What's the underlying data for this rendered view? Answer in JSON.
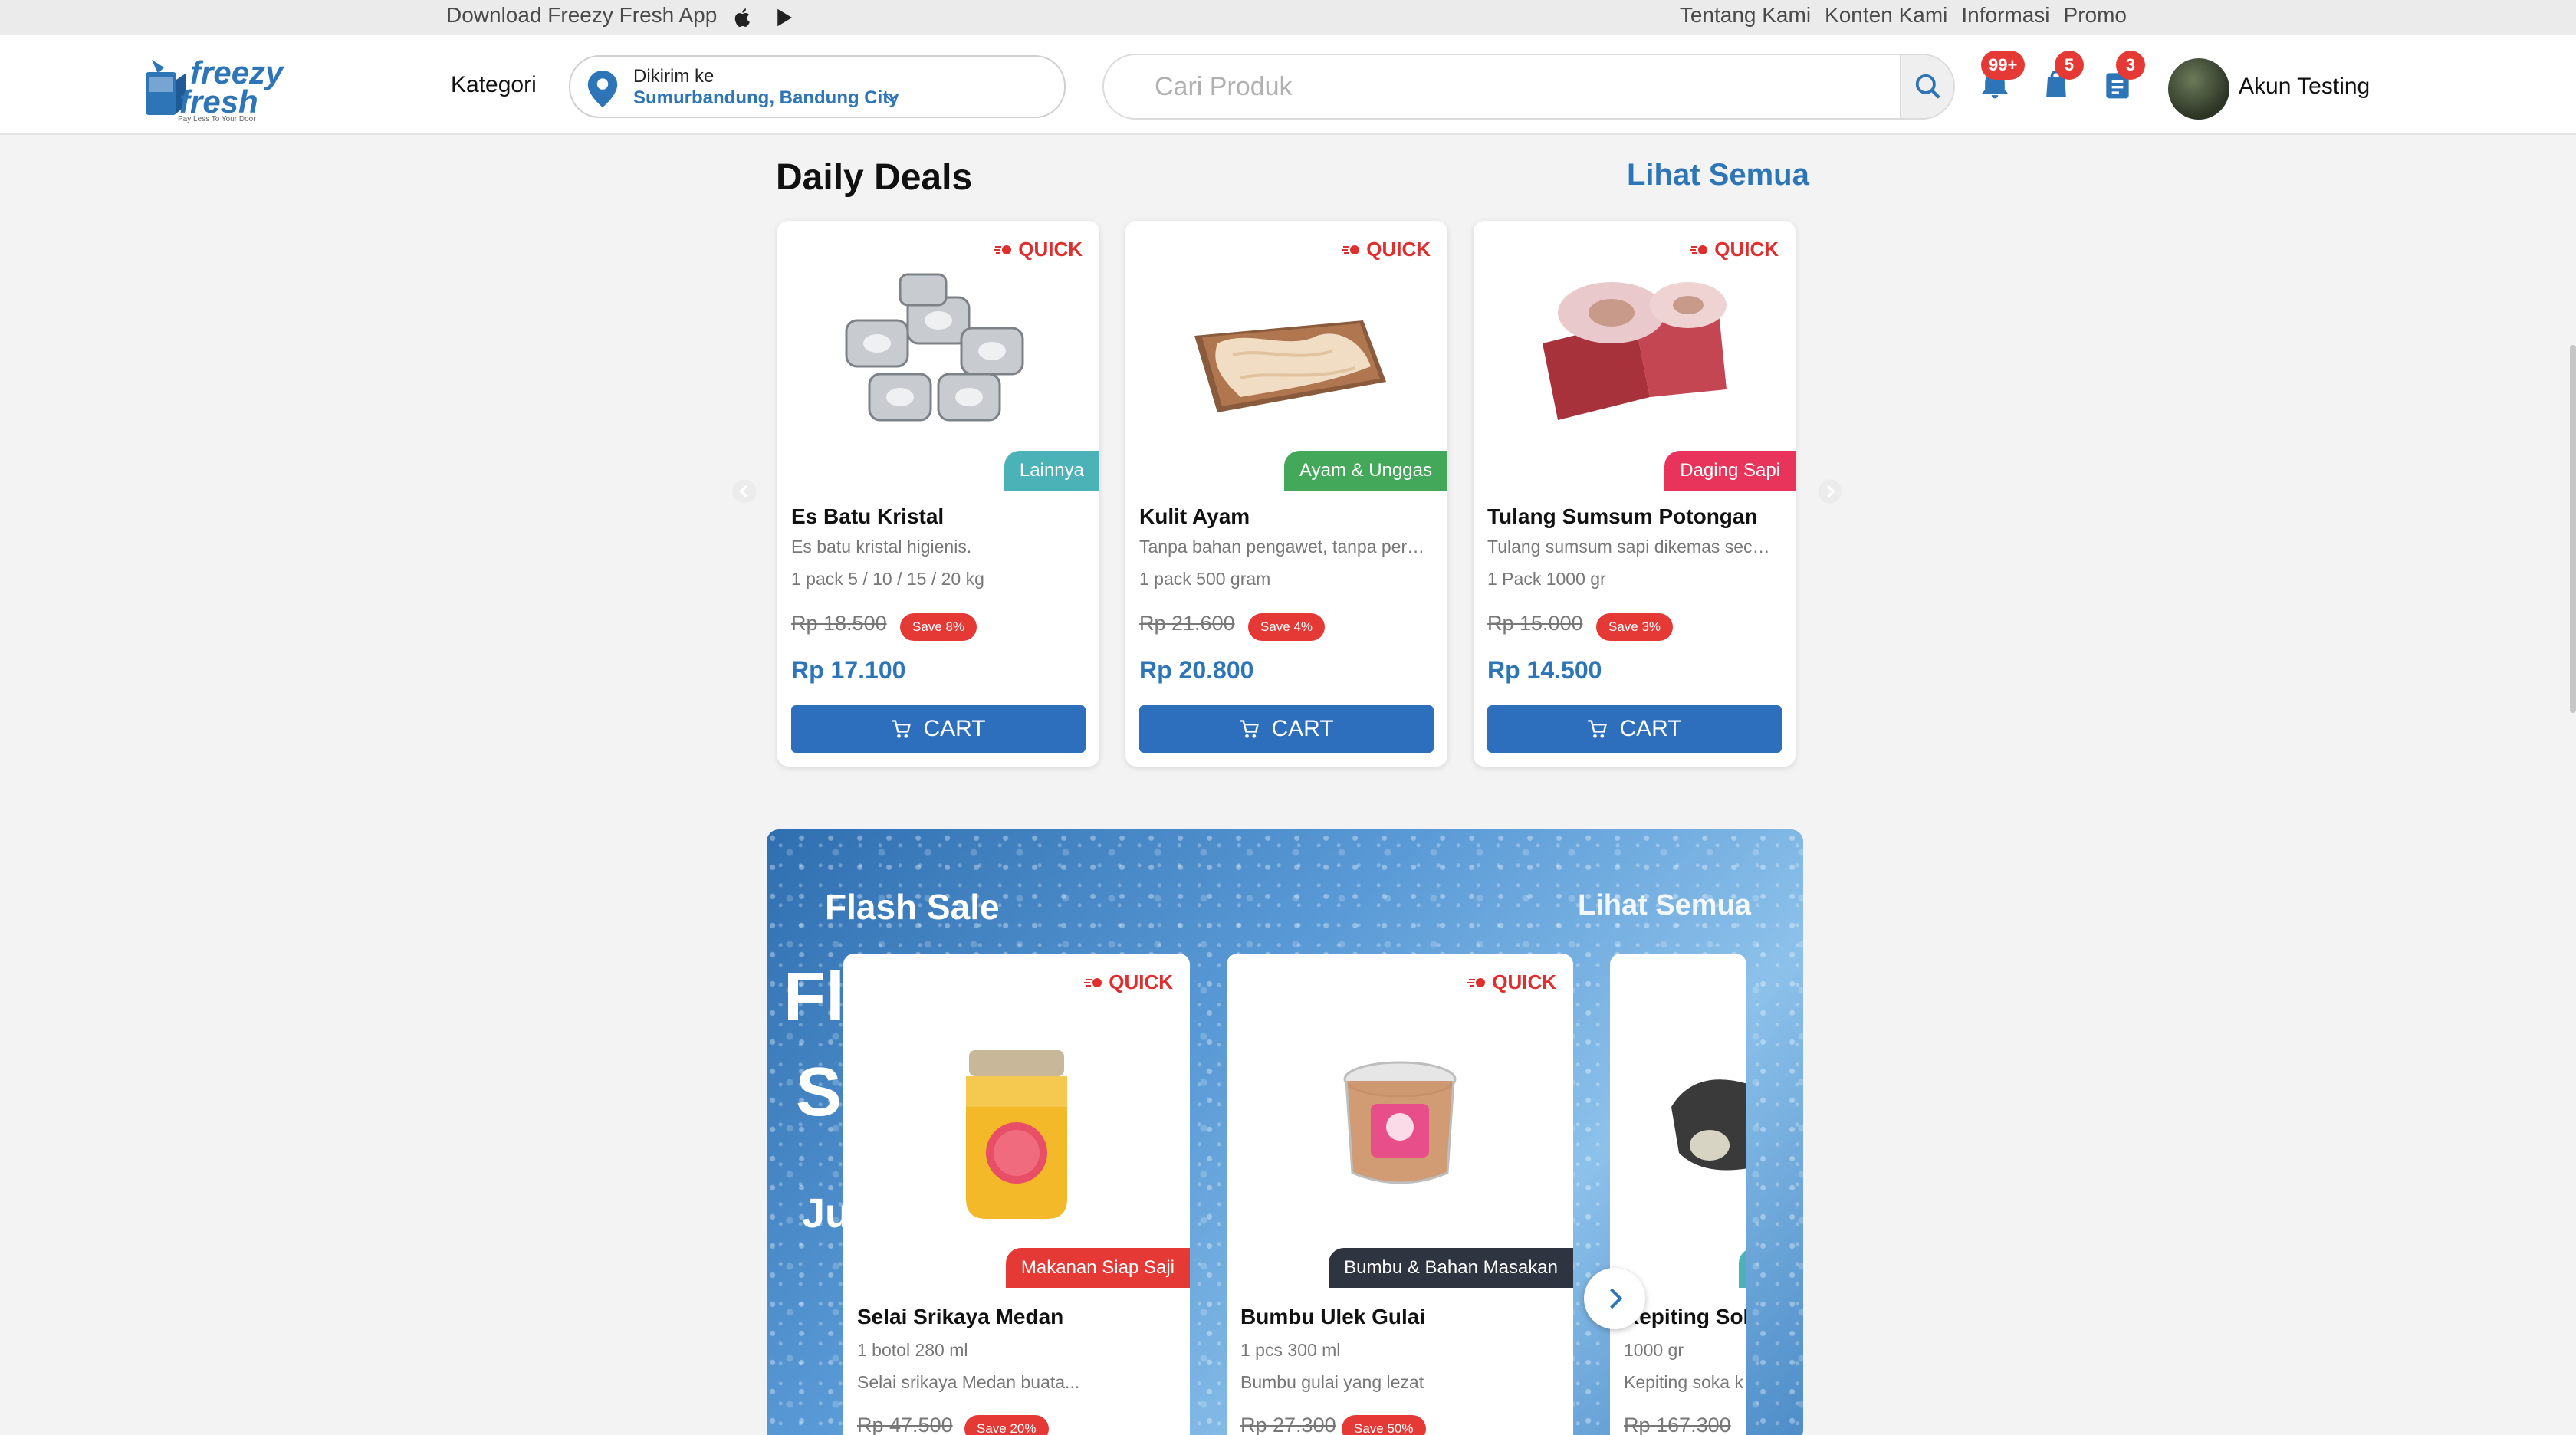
{
  "topbar": {
    "download_text": "Download Freezy Fresh App",
    "links": [
      "Tentang Kami",
      "Konten Kami",
      "Informasi",
      "Promo"
    ]
  },
  "header": {
    "logo_line1": "freezy",
    "logo_line2": "fresh",
    "logo_tagline": "Pay Less To Your Door",
    "kategori": "Kategori",
    "deliver_label": "Dikirim ke",
    "deliver_location": "Sumurbandung, Bandung City",
    "search_placeholder": "Cari Produk",
    "notif_badge": "99+",
    "bag_badge": "5",
    "orders_badge": "3",
    "account_name": "Akun Testing"
  },
  "daily_deals": {
    "title": "Daily Deals",
    "see_all": "Lihat Semua",
    "quick_label": "QUICK",
    "cart_label": "CART",
    "products": [
      {
        "name": "Es Batu Kristal",
        "desc": "Es batu kristal higienis.",
        "pack": "1 pack 5 / 10 / 15 / 20 kg",
        "old_price": "Rp 18.500",
        "save": "Save 8%",
        "price": "Rp 17.100",
        "category": "Lainnya",
        "category_color": "#4bb3b8"
      },
      {
        "name": "Kulit Ayam",
        "desc": "Tanpa bahan pengawet, tanpa pera...",
        "pack": "1 pack 500 gram",
        "old_price": "Rp 21.600",
        "save": "Save 4%",
        "price": "Rp 20.800",
        "category": "Ayam & Unggas",
        "category_color": "#43a85a"
      },
      {
        "name": "Tulang Sumsum Potongan",
        "desc": "Tulang sumsum sapi dikemas secar...",
        "pack": "1 Pack 1000 gr",
        "old_price": "Rp 15.000",
        "save": "Save 3%",
        "price": "Rp 14.500",
        "category": "Daging Sapi",
        "category_color": "#e8345a"
      }
    ]
  },
  "flash_sale": {
    "title": "Flash Sale",
    "see_all": "Lihat Semua",
    "bg_text": [
      "Fl",
      "S",
      "Ju"
    ],
    "quick_label": "QUICK",
    "products": [
      {
        "name": "Selai Srikaya Medan",
        "pack": "1 botol 280 ml",
        "desc": "Selai srikaya Medan buata...",
        "old_price": "Rp 47.500",
        "save": "Save 20%",
        "category": "Makanan Siap Saji",
        "category_color": "#e53935"
      },
      {
        "name": "Bumbu Ulek Gulai",
        "pack": "1 pcs 300 ml",
        "desc": "Bumbu gulai yang lezat",
        "old_price": "Rp 27.300",
        "save": "Save 50%",
        "category": "Bumbu & Bahan Masakan",
        "category_color": "#2e3440"
      },
      {
        "name": "Kepiting Soka",
        "pack": "1000 gr",
        "desc": "Kepiting soka k",
        "old_price": "Rp 167.300",
        "save": "",
        "category": "",
        "category_color": "#4bb3b8"
      }
    ]
  },
  "colors": {
    "brand_blue": "#2e75b8",
    "cart_blue": "#2e6fbd",
    "badge_red": "#e53935"
  }
}
